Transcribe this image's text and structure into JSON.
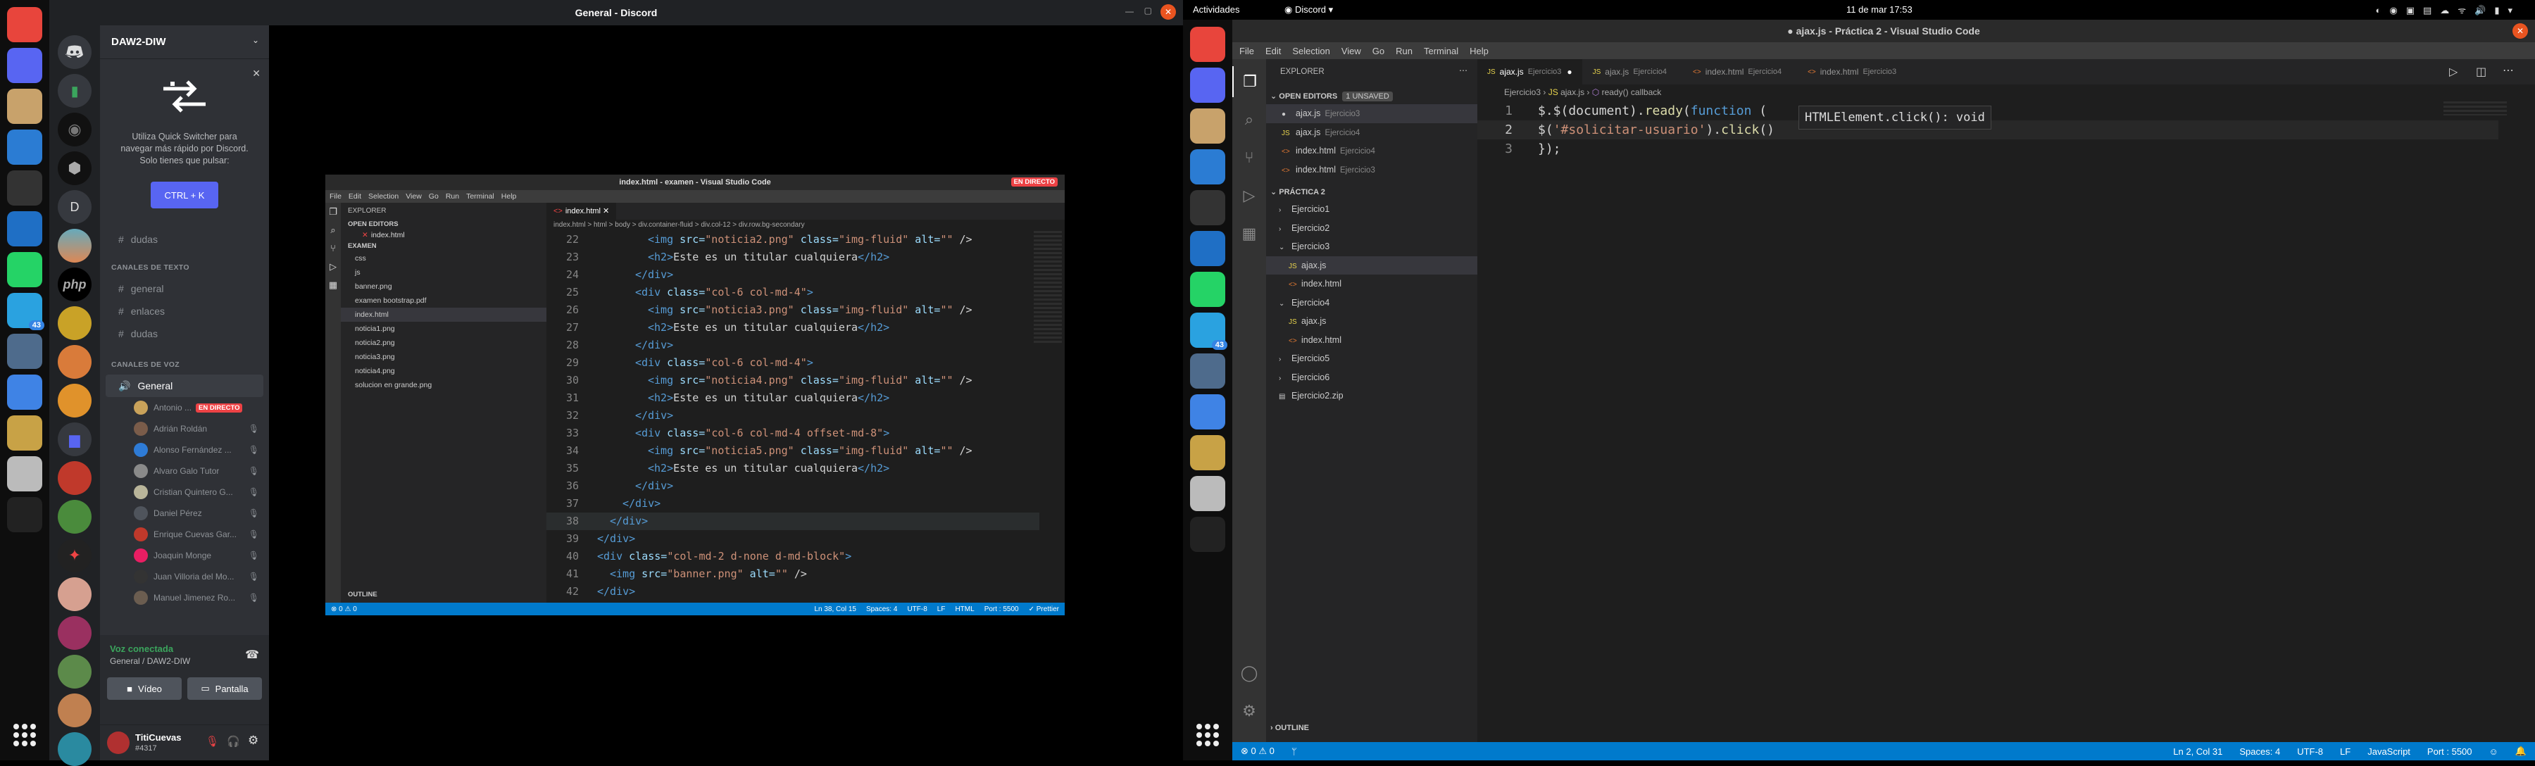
{
  "top_bar": {
    "activities": "Actividades",
    "app_menu": "Discord",
    "clock": "11 de mar  17:53"
  },
  "discord": {
    "window_title": "General - Discord",
    "server_name": "DAW2-DIW",
    "quick_switcher": {
      "text": "Utiliza Quick Switcher para navegar más rápido por Discord. Solo tienes que pulsar:",
      "shortcut": "CTRL + K"
    },
    "channels_top": [
      {
        "name": "dudas"
      }
    ],
    "text_category": "CANALES DE TEXTO",
    "text_channels": [
      {
        "name": "general"
      },
      {
        "name": "enlaces"
      },
      {
        "name": "dudas"
      }
    ],
    "voice_category": "CANALES DE VOZ",
    "voice_channel": "General",
    "voice_users": [
      {
        "name": "Antonio ...",
        "live": "EN DIRECTO",
        "color": "#c9a25a"
      },
      {
        "name": "Adrián Roldán",
        "color": "#7a5c4a"
      },
      {
        "name": "Alonso Fernández ...",
        "color": "#2e7bd6"
      },
      {
        "name": "Alvaro Galo Tutor",
        "color": "#8a8a8a"
      },
      {
        "name": "Cristian Quintero G...",
        "color": "#b9b59a"
      },
      {
        "name": "Daniel Pérez",
        "color": "#4f545c"
      },
      {
        "name": "Enrique Cuevas Gar...",
        "color": "#c0392b"
      },
      {
        "name": "Joaquin Monge",
        "color": "#e91e63"
      },
      {
        "name": "Juan Villoria del Mo...",
        "color": "#333"
      },
      {
        "name": "Manuel Jimenez Ro...",
        "color": "#6b5d50"
      }
    ],
    "voice_status": "Voz conectada",
    "voice_location": "General / DAW2-DIW",
    "video_btn": "Vídeo",
    "screen_btn": "Pantalla",
    "user_name": "TitiCuevas",
    "user_tag": "#4317",
    "live_badge": "EN DIRECTO"
  },
  "shared_screen": {
    "title": "index.html - examen - Visual Studio Code",
    "menu": [
      "File",
      "Edit",
      "Selection",
      "View",
      "Go",
      "Run",
      "Terminal",
      "Help"
    ],
    "explorer_label": "EXPLORER",
    "open_editors": "OPEN EDITORS",
    "open_file": "index.html",
    "folder": "EXAMEN",
    "files": [
      "css",
      "js",
      "banner.png",
      "examen bootstrap.pdf",
      "index.html",
      "noticia1.png",
      "noticia2.png",
      "noticia3.png",
      "noticia4.png",
      "solucion en grande.png"
    ],
    "outline": "OUTLINE",
    "tab": "index.html",
    "breadcrumb": "index.html > html > body > div.container-fluid > div.col-12 > div.row.bg-secondary",
    "lines": [
      {
        "n": "22",
        "indent": 5,
        "code": "<img src=\"noticia2.png\" class=\"img-fluid\" alt=\"\" />"
      },
      {
        "n": "23",
        "indent": 5,
        "code": "<h2>Este es un titular cualquiera</h2>"
      },
      {
        "n": "24",
        "indent": 4,
        "code": "</div>"
      },
      {
        "n": "25",
        "indent": 4,
        "code": "<div class=\"col-6 col-md-4\">"
      },
      {
        "n": "26",
        "indent": 5,
        "code": "<img src=\"noticia3.png\" class=\"img-fluid\" alt=\"\" />"
      },
      {
        "n": "27",
        "indent": 5,
        "code": "<h2>Este es un titular cualquiera</h2>"
      },
      {
        "n": "28",
        "indent": 4,
        "code": "</div>"
      },
      {
        "n": "29",
        "indent": 4,
        "code": "<div class=\"col-6 col-md-4\">"
      },
      {
        "n": "30",
        "indent": 5,
        "code": "<img src=\"noticia4.png\" class=\"img-fluid\" alt=\"\" />"
      },
      {
        "n": "31",
        "indent": 5,
        "code": "<h2>Este es un titular cualquiera</h2>"
      },
      {
        "n": "32",
        "indent": 4,
        "code": "</div>"
      },
      {
        "n": "33",
        "indent": 4,
        "code": "<div class=\"col-6 col-md-4 offset-md-8\">"
      },
      {
        "n": "34",
        "indent": 5,
        "code": "<img src=\"noticia5.png\" class=\"img-fluid\" alt=\"\" />"
      },
      {
        "n": "35",
        "indent": 5,
        "code": "<h2>Este es un titular cualquiera</h2>"
      },
      {
        "n": "36",
        "indent": 4,
        "code": "</div>"
      },
      {
        "n": "37",
        "indent": 3,
        "code": "</div>"
      },
      {
        "n": "38",
        "indent": 2,
        "code": "</div>"
      },
      {
        "n": "39",
        "indent": 1,
        "code": "</div>"
      },
      {
        "n": "40",
        "indent": 1,
        "code": "<div class=\"col-md-2 d-none d-md-block\">"
      },
      {
        "n": "41",
        "indent": 2,
        "code": "<img src=\"banner.png\" alt=\"\" />"
      },
      {
        "n": "42",
        "indent": 1,
        "code": "</div>"
      }
    ],
    "status": {
      "errors": "⊗ 0  ⚠ 0",
      "pos": "Ln 38, Col 15",
      "spaces": "Spaces: 4",
      "enc": "UTF-8",
      "eol": "LF",
      "lang": "HTML",
      "port": "Port : 5500",
      "prettier": "✓ Prettier"
    }
  },
  "vscode": {
    "title": "● ajax.js - Práctica 2 - Visual Studio Code",
    "menu": [
      "File",
      "Edit",
      "Selection",
      "View",
      "Go",
      "Run",
      "Terminal",
      "Help"
    ],
    "explorer_label": "EXPLORER",
    "open_editors": "OPEN EDITORS",
    "unsaved": "1 UNSAVED",
    "open_editor_items": [
      {
        "icon": "●",
        "name": "ajax.js",
        "dir": "Ejercicio3"
      },
      {
        "icon": "JS",
        "name": "ajax.js",
        "dir": "Ejercicio4"
      },
      {
        "icon": "<>",
        "name": "index.html",
        "dir": "Ejercicio4"
      },
      {
        "icon": "<>",
        "name": "index.html",
        "dir": "Ejercicio3"
      }
    ],
    "project": "PRÁCTICA 2",
    "tree": [
      {
        "label": "Ejercicio1",
        "arrow": "›",
        "level": 0
      },
      {
        "label": "Ejercicio2",
        "arrow": "›",
        "level": 0
      },
      {
        "label": "Ejercicio3",
        "arrow": "⌄",
        "level": 0
      },
      {
        "label": "ajax.js",
        "arrow": "JS",
        "level": 1
      },
      {
        "label": "index.html",
        "arrow": "<>",
        "level": 1
      },
      {
        "label": "Ejercicio4",
        "arrow": "⌄",
        "level": 0
      },
      {
        "label": "ajax.js",
        "arrow": "JS",
        "level": 1
      },
      {
        "label": "index.html",
        "arrow": "<>",
        "level": 1
      },
      {
        "label": "Ejercicio5",
        "arrow": "›",
        "level": 0
      },
      {
        "label": "Ejercicio6",
        "arrow": "›",
        "level": 0
      },
      {
        "label": "Ejercicio2.zip",
        "arrow": "▤",
        "level": 0
      }
    ],
    "outline": "OUTLINE",
    "tabs": [
      {
        "icon": "JS",
        "name": "ajax.js",
        "dir": "Ejercicio3",
        "active": true
      },
      {
        "icon": "JS",
        "name": "ajax.js",
        "dir": "Ejercicio4",
        "active": false
      },
      {
        "icon": "<>",
        "name": "index.html",
        "dir": "Ejercicio4",
        "active": false
      },
      {
        "icon": "<>",
        "name": "index.html",
        "dir": "Ejercicio3",
        "active": false
      }
    ],
    "breadcrumb": [
      "Ejercicio3",
      "ajax.js",
      "ready() callback"
    ],
    "code": [
      {
        "n": "1",
        "text": "$.$(document).ready(function ("
      },
      {
        "n": "2",
        "text": "$('#solicitar-usuario').click()"
      },
      {
        "n": "3",
        "text": "});"
      }
    ],
    "hover": "HTMLElement.click(): void",
    "status": {
      "errors": "⊗ 0 ⚠ 0",
      "pos": "Ln 2, Col 31",
      "spaces": "Spaces: 4",
      "enc": "UTF-8",
      "eol": "LF",
      "lang": "JavaScript",
      "port": "Port : 5500"
    }
  }
}
